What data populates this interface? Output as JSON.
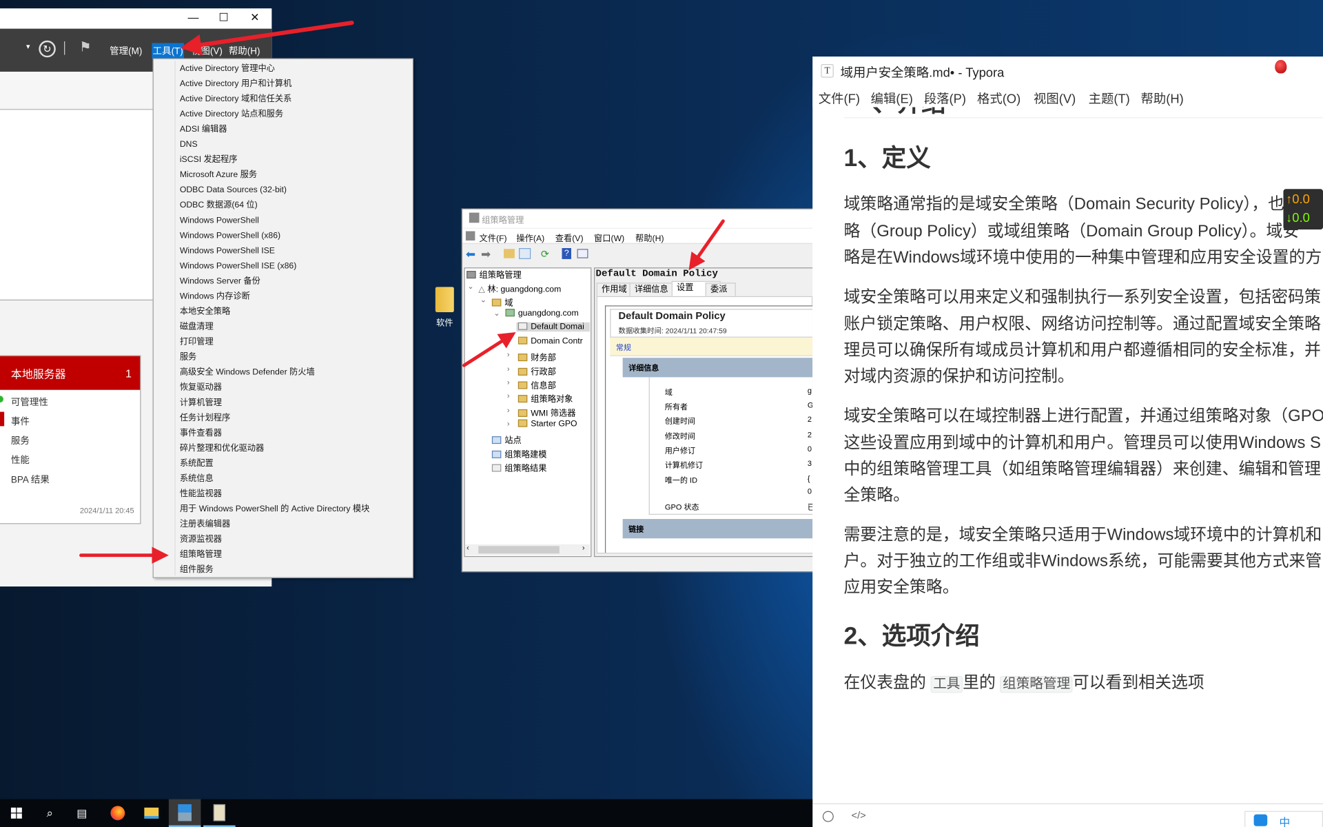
{
  "server_manager": {
    "window_controls": {
      "minimize": "—",
      "maximize": "☐",
      "close": "✕"
    },
    "toolbar_menus": [
      "管理(M)",
      "工具(T)",
      "视图(V)",
      "帮助(H)"
    ],
    "tile": {
      "title": "本地服务器",
      "count": "1",
      "items": [
        "可管理性",
        "事件",
        "服务",
        "性能",
        "BPA 结果"
      ],
      "timestamp": "2024/1/11 20:45"
    },
    "accent": "#c00000"
  },
  "tools_menu": {
    "items": [
      "Active Directory 管理中心",
      "Active Directory 用户和计算机",
      "Active Directory 域和信任关系",
      "Active Directory 站点和服务",
      "ADSI 编辑器",
      "DNS",
      "iSCSI 发起程序",
      "Microsoft Azure 服务",
      "ODBC Data Sources (32-bit)",
      "ODBC 数据源(64 位)",
      "Windows PowerShell",
      "Windows PowerShell (x86)",
      "Windows PowerShell ISE",
      "Windows PowerShell ISE (x86)",
      "Windows Server 备份",
      "Windows 内存诊断",
      "本地安全策略",
      "磁盘清理",
      "打印管理",
      "服务",
      "高级安全 Windows Defender 防火墙",
      "恢复驱动器",
      "计算机管理",
      "任务计划程序",
      "事件查看器",
      "碎片整理和优化驱动器",
      "系统配置",
      "系统信息",
      "性能监视器",
      "用于 Windows PowerShell 的 Active Directory 模块",
      "注册表编辑器",
      "资源监视器",
      "组策略管理",
      "组件服务"
    ]
  },
  "desktop": {
    "folder_label": "软件"
  },
  "gpm": {
    "title": "组策略管理",
    "menus": [
      "文件(F)",
      "操作(A)",
      "查看(V)",
      "窗口(W)",
      "帮助(H)"
    ],
    "tree": [
      "组策略管理",
      "林: guangdong.com",
      "域",
      "guangdong.com",
      "Default Domai",
      "Domain Contr",
      "财务部",
      "行政部",
      "信息部",
      "组策略对象",
      "WMI 筛选器",
      "Starter GPO",
      "站点",
      "组策略建模",
      "组策略结果"
    ],
    "header": "Default Domain Policy",
    "tabs": [
      "作用域",
      "详细信息",
      "设置",
      "委派"
    ],
    "report_title": "Default Domain Policy",
    "collected": "数据收集时间: 2024/1/11 20:47:59",
    "general": "常规",
    "details": "详细信息",
    "labels": [
      "域",
      "所有者",
      "创建时间",
      "修改时间",
      "用户修订",
      "计算机修订",
      "唯一的 ID",
      "GPO 状态"
    ],
    "values": [
      "g",
      "G",
      "2",
      "2",
      "0",
      "3",
      "{",
      "0",
      "已"
    ],
    "links": "链接"
  },
  "typora": {
    "title": "域用户安全策略.md• - Typora",
    "menus": [
      "文件(F)",
      "编辑(E)",
      "段落(P)",
      "格式(O)",
      "视图(V)",
      "主题(T)",
      "帮助(H)"
    ],
    "prev_heading": "一、介绍",
    "h1": "1、定义",
    "p1": [
      "域策略通常指的是域安全策略（Domain Security Policy），也称",
      "略（Group Policy）或域组策略（Domain Group Policy）。域安",
      "略是在Windows域环境中使用的一种集中管理和应用安全设置的方"
    ],
    "p2": [
      "域安全策略可以用来定义和强制执行一系列安全设置，包括密码策",
      "账户锁定策略、用户权限、网络访问控制等。通过配置域安全策略",
      "理员可以确保所有域成员计算机和用户都遵循相同的安全标准，并",
      "对域内资源的保护和访问控制。"
    ],
    "p3": [
      "域安全策略可以在域控制器上进行配置，并通过组策略对象（GPO",
      "这些设置应用到域中的计算机和用户。管理员可以使用Windows S",
      "中的组策略管理工具（如组策略管理编辑器）来创建、编辑和管理",
      "全策略。"
    ],
    "p4": [
      "需要注意的是，域安全策略只适用于Windows域环境中的计算机和",
      "户。对于独立的工作组或非Windows系统，可能需要其他方式来管",
      "应用安全策略。"
    ],
    "h2": "2、选项介绍",
    "p5": {
      "a": "在仪表盘的 ",
      "code1": "工具",
      "b": "里的 ",
      "code2": "组策略管理",
      "c": "可以看到相关选项"
    },
    "net_up": "↑0.0",
    "net_down": "↓0.0",
    "status_code": "</>",
    "ime": "中"
  }
}
